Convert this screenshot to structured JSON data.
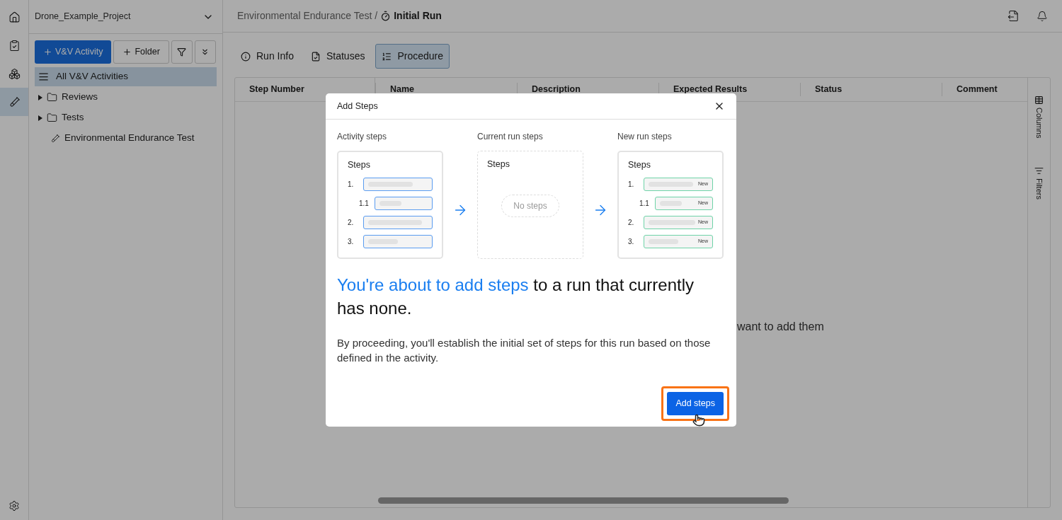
{
  "rail": {
    "items": [
      {
        "kind": "home",
        "selected": false
      },
      {
        "kind": "clipboard",
        "selected": false
      },
      {
        "kind": "boxes",
        "selected": false
      },
      {
        "kind": "tube",
        "selected": true
      }
    ],
    "bottom": {
      "kind": "settings"
    }
  },
  "sidebar": {
    "project": "Drone_Example_Project",
    "buttons": [
      {
        "kind": "primary",
        "label": "V&V Activity"
      },
      {
        "kind": "secondary",
        "label": "Folder"
      },
      {
        "kind": "filter"
      },
      {
        "kind": "collapse"
      }
    ],
    "tree": [
      {
        "kind": "all",
        "label": "All V&V Activities",
        "selected": true
      },
      {
        "kind": "folder",
        "label": "Reviews",
        "expanded": false,
        "selected": false
      },
      {
        "kind": "folder",
        "label": "Tests",
        "expanded": false,
        "selected": false
      },
      {
        "kind": "activity",
        "label": "Environmental Endurance Test",
        "selected": false
      }
    ]
  },
  "header": {
    "breadcrumb": "Environmental Endurance Test /",
    "current": "Initial Run"
  },
  "tabs": [
    {
      "kind": "info",
      "label": "Run Info",
      "selected": false
    },
    {
      "kind": "statuses",
      "label": "Statuses",
      "selected": false
    },
    {
      "kind": "procedure",
      "label": "Procedure",
      "selected": true
    }
  ],
  "table": {
    "columns": [
      "Step Number",
      "Name",
      "Description",
      "Expected Results",
      "Status",
      "Comment"
    ],
    "empty_text": "want to add them",
    "side_panels": [
      {
        "kind": "columns",
        "label": "Columns"
      },
      {
        "kind": "filters",
        "label": "Filters"
      }
    ]
  },
  "dialog": {
    "title": "Add Steps",
    "panels": [
      {
        "kind": "activity",
        "label": "Activity steps",
        "card_title": "Steps",
        "steps": [
          {
            "number": "1.",
            "children": [
              {
                "number": "1.1"
              }
            ]
          },
          {
            "number": "2."
          },
          {
            "number": "3."
          }
        ]
      },
      {
        "kind": "current",
        "label": "Current run steps",
        "card_title": "Steps",
        "empty_text": "No steps"
      },
      {
        "kind": "new",
        "label": "New run steps",
        "card_title": "Steps",
        "steps": [
          {
            "number": "1.",
            "badge": "New",
            "children": [
              {
                "number": "1.1",
                "badge": "New"
              }
            ]
          },
          {
            "number": "2.",
            "badge": "New"
          },
          {
            "number": "3.",
            "badge": "New"
          }
        ]
      }
    ],
    "headline_highlight": "You're about to add steps",
    "headline_rest": "to a run that currently has none.",
    "body": "By proceeding, you'll establish the initial set of steps for this run based on those defined in the activity.",
    "button": {
      "label": "Add steps",
      "highlighted": true
    }
  }
}
